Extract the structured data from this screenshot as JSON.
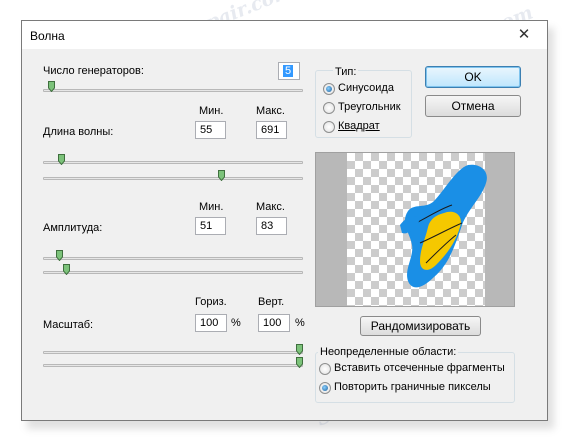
{
  "window": {
    "title": "Волна",
    "close_glyph": "✕"
  },
  "generators": {
    "label": "Число генераторов:",
    "value": "5",
    "slider_fraction": 0.02
  },
  "wavelength": {
    "label": "Длина волны:",
    "min_header": "Мин.",
    "max_header": "Макс.",
    "min_value": "55",
    "max_value": "691",
    "min_slider_fraction": 0.06,
    "max_slider_fraction": 0.69
  },
  "amplitude": {
    "label": "Амплитуда:",
    "min_header": "Мин.",
    "max_header": "Макс.",
    "min_value": "51",
    "max_value": "83",
    "min_slider_fraction": 0.05,
    "max_slider_fraction": 0.08
  },
  "scale": {
    "label": "Масштаб:",
    "horiz_header": "Гориз.",
    "vert_header": "Верт.",
    "horiz_value": "100",
    "vert_value": "100",
    "unit": "%",
    "horiz_slider_fraction": 1.0,
    "vert_slider_fraction": 1.0
  },
  "type_group": {
    "label": "Тип:",
    "options": [
      "Синусоида",
      "Треугольник",
      "Квадрат"
    ],
    "selected": "Синусоида"
  },
  "buttons": {
    "ok": "OK",
    "cancel": "Отмена",
    "randomize": "Рандомизировать"
  },
  "undefined_areas": {
    "label": "Неопределенные области:",
    "options": [
      "Вставить отсеченные фрагменты",
      "Повторить граничные пикселы"
    ],
    "selected": "Повторить граничные пикселы"
  },
  "watermark": "Soringpcrepair.com",
  "colors": {
    "accent": "#1f8fe8",
    "blob_blue": "#1a8fe6",
    "blob_yellow": "#f5c800"
  }
}
